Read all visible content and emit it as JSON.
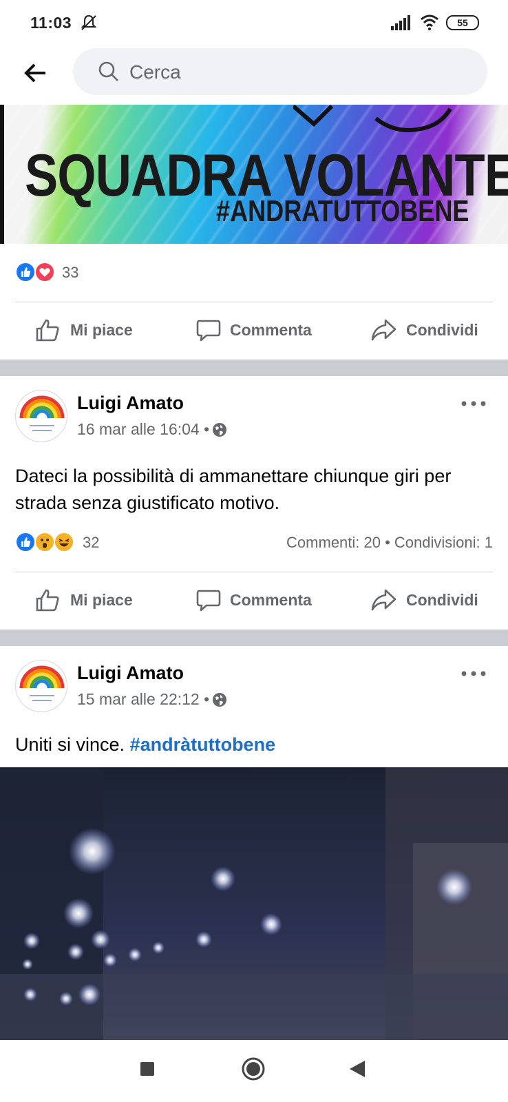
{
  "status_bar": {
    "time": "11:03",
    "battery": "55"
  },
  "search": {
    "placeholder": "Cerca"
  },
  "banner": {
    "title": "SQUADRA VOLANTE",
    "hashtag": "#ANDRATUTTOBENE"
  },
  "post1": {
    "reaction_count": "33"
  },
  "actions": {
    "like": "Mi piace",
    "comment": "Commenta",
    "share": "Condividi"
  },
  "post2": {
    "author": "Luigi Amato",
    "meta": "16 mar alle 16:04 •",
    "text": "Dateci la possibilità di ammanettare chiunque giri per strada senza giustificato motivo.",
    "reaction_count": "32",
    "stats": "Commenti: 20 • Condivisioni: 1"
  },
  "post3": {
    "author": "Luigi Amato",
    "meta": "15 mar alle 22:12 •",
    "text": "Uniti si vince.",
    "hashtag": "#andràtuttobene"
  },
  "colors": {
    "like_blue": "#1877f2",
    "love_red": "#f33e58",
    "haha_yellow": "#f7b125",
    "hashtag": "#1b6fc8",
    "separator": "#c9ccd1"
  }
}
